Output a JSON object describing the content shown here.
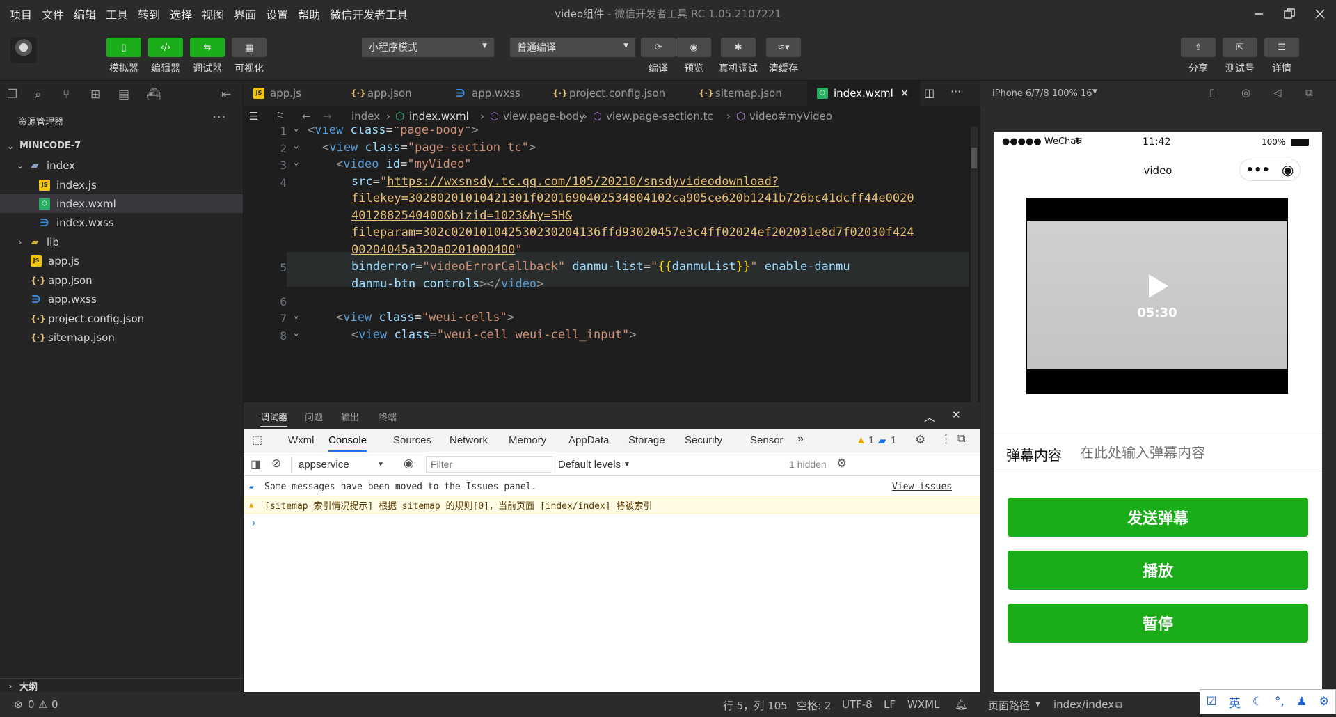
{
  "menubar": {
    "items": [
      "项目",
      "文件",
      "编辑",
      "工具",
      "转到",
      "选择",
      "视图",
      "界面",
      "设置",
      "帮助",
      "微信开发者工具"
    ],
    "title": "video组件",
    "subtitle": " - 微信开发者工具 RC 1.05.2107221"
  },
  "toolbar": {
    "simulator": "模拟器",
    "editor": "编辑器",
    "debugger": "调试器",
    "visual": "可视化",
    "mode_select": "小程序模式",
    "compile_select": "普通编译",
    "compile": "编译",
    "preview": "预览",
    "device_debug": "真机调试",
    "clear_cache": "清缓存",
    "share": "分享",
    "test_account": "测试号",
    "details": "详情"
  },
  "explorer": {
    "title": "资源管理器",
    "more": "···",
    "project": "MINICODE-7",
    "tree": [
      {
        "label": "index",
        "kind": "folder"
      },
      {
        "label": "index.js",
        "kind": "js"
      },
      {
        "label": "index.wxml",
        "kind": "wxml"
      },
      {
        "label": "index.wxss",
        "kind": "wxss"
      },
      {
        "label": "lib",
        "kind": "lib"
      },
      {
        "label": "app.js",
        "kind": "js"
      },
      {
        "label": "app.json",
        "kind": "json"
      },
      {
        "label": "app.wxss",
        "kind": "wxss"
      },
      {
        "label": "project.config.json",
        "kind": "json"
      },
      {
        "label": "sitemap.json",
        "kind": "json"
      }
    ],
    "outline": "大纲"
  },
  "tabs": [
    "app.js",
    "app.json",
    "app.wxss",
    "project.config.json",
    "sitemap.json",
    "index.wxml"
  ],
  "breadcrumb": [
    "index",
    "index.wxml",
    "view.page-body",
    "view.page-section.tc",
    "video#myVideo"
  ],
  "code": {
    "line_numbers": [
      "1",
      "2",
      "3",
      "4",
      "5",
      "6",
      "7",
      "8"
    ],
    "url_1": "https://wxsnsdy.tc.qq.com/105/20210/snsdyvideodownload?",
    "url_2": "filekey=30280201010421301f0201690402534804102ca905ce620b1241b726bc41dcff44e0020",
    "url_3": "4012882540400&bizid=1023&hy=SH&",
    "url_4": "fileparam=302c020101042530230204136ffd93020457e3c4ff02024ef202031e8d7f02030f424",
    "url_5": "00204045a320a0201000400"
  },
  "debugger": {
    "panel_tabs": [
      "调试器",
      "问题",
      "输出",
      "终端"
    ],
    "dev_tabs": [
      "Wxml",
      "Console",
      "Sources",
      "Network",
      "Memory",
      "AppData",
      "Storage",
      "Security",
      "Sensor"
    ],
    "warn_count": "1",
    "info_count": "1",
    "context": "appservice",
    "filter_placeholder": "Filter",
    "levels": "Default levels",
    "hidden": "1 hidden",
    "msg_info": "Some messages have been moved to the Issues panel.",
    "view_issues": "View issues",
    "msg_warn": "[sitemap 索引情况提示] 根据 sitemap 的规则[0]，当前页面 [index/index] 将被索引"
  },
  "simulator": {
    "device": "iPhone 6/7/8 100% 16",
    "carrier": "●●●●● WeChat",
    "time": "11:42",
    "battery": "100%",
    "page_title": "video",
    "duration": "05:30",
    "danmu_label": "弹幕内容",
    "danmu_placeholder": "在此处输入弹幕内容",
    "btn_send": "发送弹幕",
    "btn_play": "播放",
    "btn_pause": "暂停"
  },
  "status": {
    "errors": "0",
    "warnings": "0",
    "position": "行 5，列 105",
    "spaces": "空格: 2",
    "encoding": "UTF-8",
    "eol": "LF",
    "language": "WXML",
    "page_path_label": "页面路径",
    "page_path": "index/index"
  },
  "ime": [
    "英"
  ]
}
